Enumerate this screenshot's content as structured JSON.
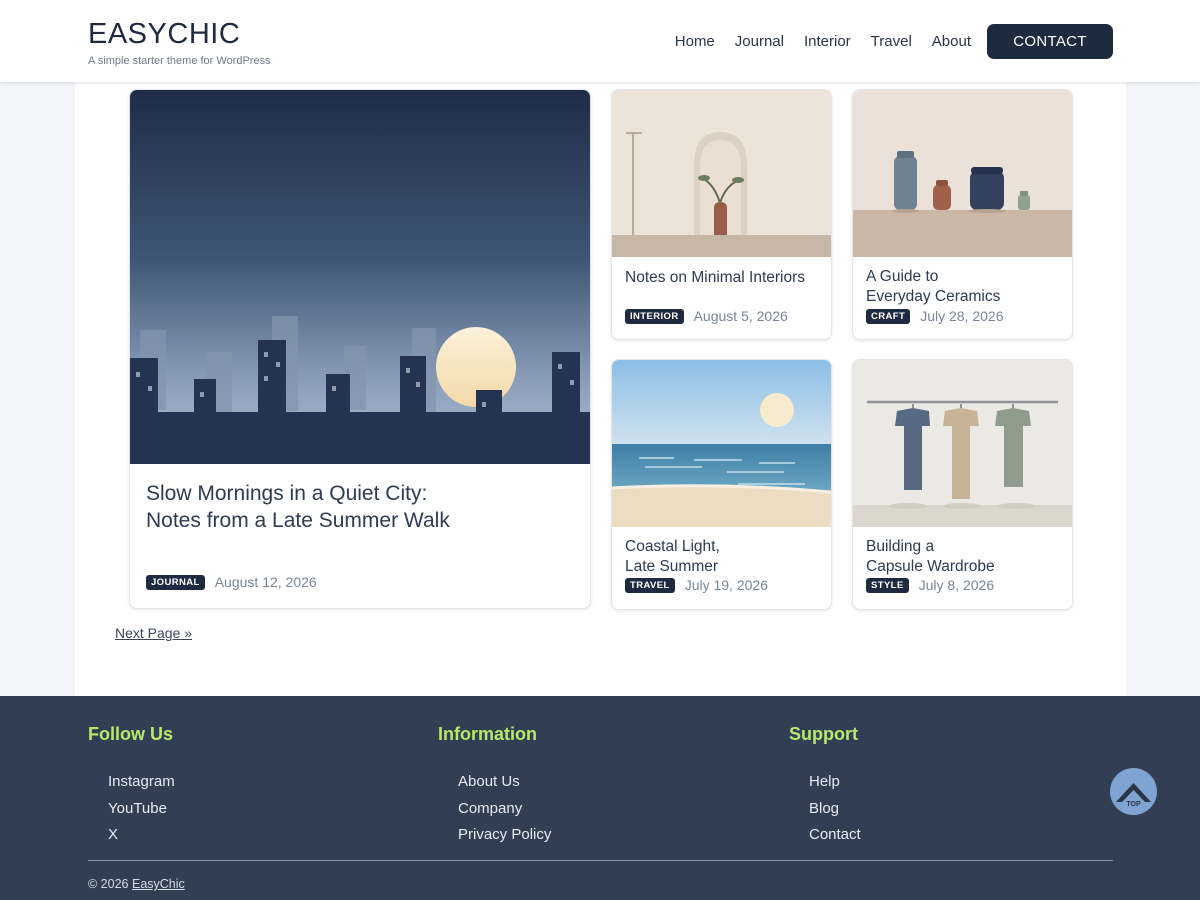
{
  "site": {
    "title": "EASYCHIC",
    "tagline": "A simple starter theme for WordPress"
  },
  "nav": {
    "items": [
      "Home",
      "Journal",
      "Interior",
      "Travel",
      "About"
    ],
    "contact_label": "CONTACT"
  },
  "posts": [
    {
      "title_line1": "Slow Mornings in a Quiet City:",
      "title_line2": "Notes from a Late Summer Walk",
      "category": "JOURNAL",
      "date": "August 12, 2026",
      "image_icon": "city-skyline-sunset-illustration"
    },
    {
      "title_line1": "Notes on Minimal Interiors",
      "title_line2": "",
      "category": "INTERIOR",
      "date": "August 5, 2026",
      "image_icon": "arched-niche-vase-illustration"
    },
    {
      "title_line1": "A Guide to",
      "title_line2": "Everyday Ceramics",
      "category": "CRAFT",
      "date": "July 28, 2026",
      "image_icon": "ceramic-vessels-illustration"
    },
    {
      "title_line1": "Coastal Light,",
      "title_line2": "Late Summer",
      "category": "TRAVEL",
      "date": "July 19, 2026",
      "image_icon": "beach-sea-illustration"
    },
    {
      "title_line1": "Building a",
      "title_line2": "Capsule Wardrobe",
      "category": "STYLE",
      "date": "July 8, 2026",
      "image_icon": "shirts-on-rack-illustration"
    }
  ],
  "pagination": {
    "next_label": "Next Page »"
  },
  "footer": {
    "columns": [
      {
        "heading": "Follow Us",
        "links": [
          "Instagram",
          "YouTube",
          "X"
        ]
      },
      {
        "heading": "Information",
        "links": [
          "About Us",
          "Company",
          "Privacy Policy"
        ]
      },
      {
        "heading": "Support",
        "links": [
          "Help",
          "Blog",
          "Contact"
        ]
      }
    ],
    "copyright_prefix": "© 2026",
    "copyright_link": "EasyChic"
  },
  "to_top": {
    "label": "TOP",
    "icon": "chevron-up-icon"
  },
  "colors": {
    "accent_dark": "#1e2a40",
    "footer_bg": "#323e53",
    "footer_heading": "#b9e86c",
    "to_top_bg": "#7fa4d1"
  }
}
